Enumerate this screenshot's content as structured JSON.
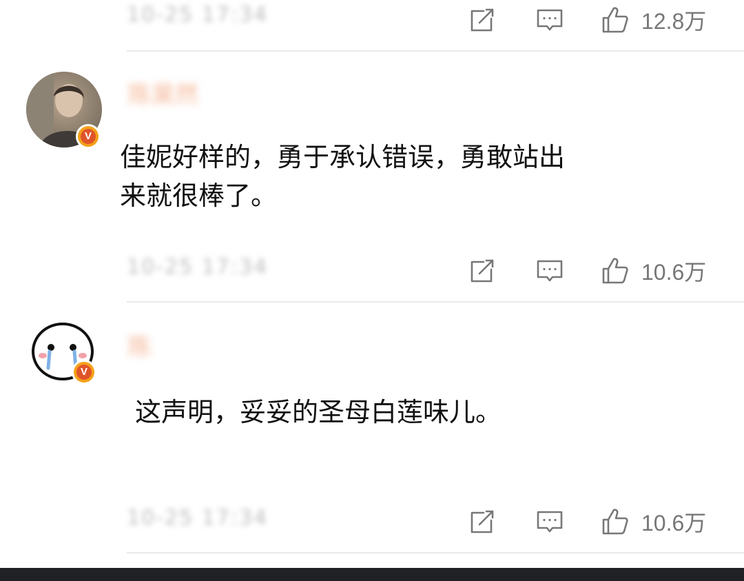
{
  "comments": [
    {
      "time": "10-25 17:34",
      "likes": "12.8万"
    },
    {
      "username": "陈昊然",
      "text_line1": "佳妮好样的，勇于承认错误，勇敢站出",
      "text_line2": "来就很棒了。",
      "time": "10-25 17:34",
      "likes": "10.6万",
      "verified_badge": "V"
    },
    {
      "username": "陈",
      "text_line1": "这声明，妥妥的圣母白莲味儿。",
      "time": "10-25 17:34",
      "likes": "10.6万",
      "verified_badge": "V"
    }
  ],
  "icons": {
    "share": "share-icon",
    "comment": "comment-icon",
    "like": "thumbs-up-icon"
  },
  "colors": {
    "badge_outer": "#f4a11a",
    "badge_inner": "#e0542a",
    "icon": "#777777",
    "divider": "#e9e9e9"
  }
}
